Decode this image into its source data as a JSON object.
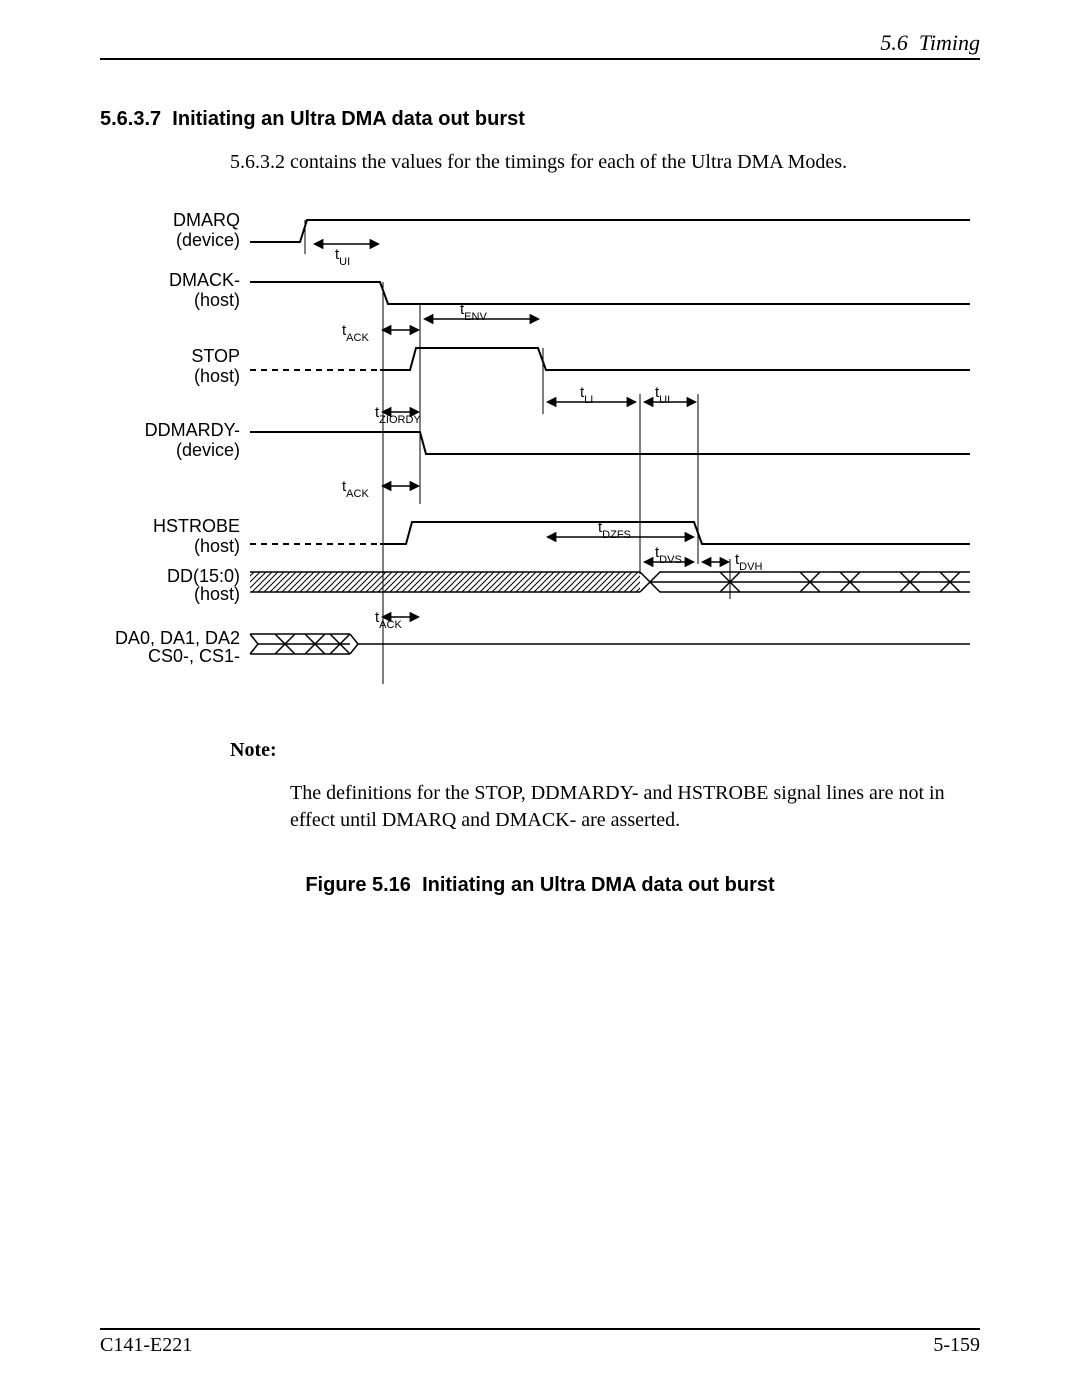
{
  "header": {
    "section": "5.6",
    "title": "Timing"
  },
  "section": {
    "number": "5.6.3.7",
    "title": "Initiating an Ultra DMA data out burst"
  },
  "intro": "5.6.3.2 contains the values for the timings for each of the Ultra DMA Modes.",
  "signals": {
    "dmarq": {
      "name": "DMARQ",
      "src": "(device)"
    },
    "dmack": {
      "name": "DMACK-",
      "src": "(host)"
    },
    "stop": {
      "name": "STOP",
      "src": "(host)"
    },
    "ddmardy": {
      "name": "DDMARDY-",
      "src": "(device)"
    },
    "hstrobe": {
      "name": "HSTROBE",
      "src": "(host)"
    },
    "dd": {
      "name": "DD(15:0)",
      "src": "(host)"
    },
    "da": {
      "name": "DA0, DA1, DA2",
      "src2": "CS0-, CS1-"
    }
  },
  "timings": {
    "tUI": "UI",
    "tACK": "ACK",
    "tENV": "ENV",
    "tZIORDY": "ZIORDY",
    "tLI": "LI",
    "tDZFS": "DZFS",
    "tDVS": "DVS",
    "tDVH": "DVH"
  },
  "note": {
    "label": "Note:",
    "text": "The definitions for the STOP, DDMARDY- and HSTROBE signal lines are not in effect until DMARQ and DMACK- are asserted."
  },
  "figure": {
    "num": "Figure 5.16",
    "title": "Initiating an Ultra DMA data out burst"
  },
  "footer": {
    "left": "C141-E221",
    "right": "5-159"
  }
}
